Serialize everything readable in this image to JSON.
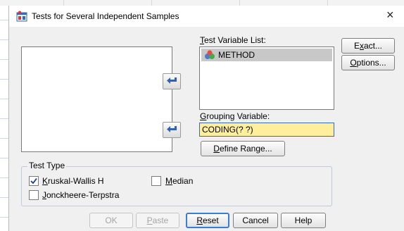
{
  "window": {
    "title": "Tests for Several Independent Samples",
    "close_glyph": "×"
  },
  "test_variable_list": {
    "label_mnemonic": "T",
    "label_rest": "est Variable List:",
    "items": [
      {
        "label": "METHOD",
        "icon": "nominal-variable-icon"
      }
    ]
  },
  "grouping_variable": {
    "label_mnemonic": "G",
    "label_rest": "rouping Variable:",
    "value": "CODING(? ?)"
  },
  "define_range": {
    "mnemonic": "D",
    "rest": "efine Range..."
  },
  "side_buttons": {
    "exact_pre": "E",
    "exact_mnemonic": "x",
    "exact_post": "act...",
    "options_mnemonic": "O",
    "options_rest": "ptions..."
  },
  "test_type": {
    "title": "Test Type",
    "kruskal": {
      "mnemonic": "K",
      "rest": "ruskal-Wallis H",
      "checked": true
    },
    "median": {
      "mnemonic": "M",
      "rest": "edian",
      "checked": false
    },
    "jonckheere": {
      "mnemonic": "J",
      "rest": "onckheere-Terpstra",
      "checked": false
    }
  },
  "bottom_buttons": {
    "ok": "OK",
    "paste_mnemonic": "P",
    "paste_rest": "aste",
    "reset_mnemonic": "R",
    "reset_rest": "eset",
    "cancel": "Cancel",
    "help": "Help"
  },
  "colors": {
    "grouping_field_bg": "#ffef9c",
    "selected_item_bg": "#c8c8c8",
    "arrow_blue": "#2a63b8",
    "focus_border": "#3d7bd9"
  }
}
